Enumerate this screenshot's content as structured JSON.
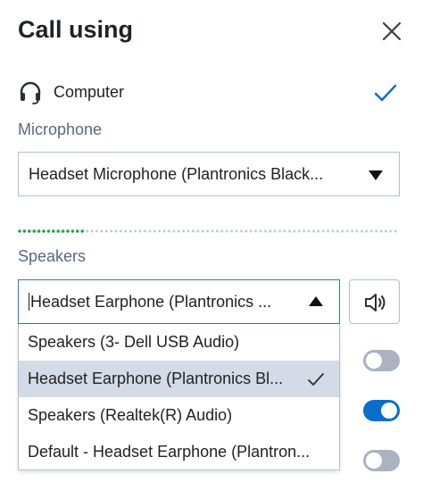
{
  "dialog": {
    "title": "Call using"
  },
  "computer": {
    "label": "Computer",
    "selected": true
  },
  "microphone": {
    "section_label": "Microphone",
    "selected_value": "Headset Microphone (Plantronics Black..."
  },
  "speakers": {
    "section_label": "Speakers",
    "selected_value": "Headset Earphone (Plantronics ...",
    "options": [
      {
        "label": "Speakers (3- Dell USB Audio)",
        "selected": false
      },
      {
        "label": "Headset Earphone (Plantronics Bl...",
        "selected": true
      },
      {
        "label": "Speakers (Realtek(R) Audio)",
        "selected": false
      },
      {
        "label": "Default - Headset Earphone (Plantron...",
        "selected": false
      }
    ]
  },
  "mic_level": {
    "active_fraction": 0.18
  },
  "toggles": [
    {
      "on": false
    },
    {
      "on": true
    },
    {
      "on": false
    }
  ],
  "colors": {
    "accent": "#0a6ecc",
    "level_active": "#1ca64a",
    "level_inactive": "#c4cbd4",
    "selected_row": "#d3dbe6",
    "toggle_off": "#aab3c0"
  },
  "icons": {
    "close": "close-icon",
    "headset": "headset-icon",
    "check": "checkmark-icon",
    "dropdown": "triangle-down-icon",
    "dropdown_open": "triangle-up-icon",
    "speaker": "speaker-volume-icon"
  }
}
